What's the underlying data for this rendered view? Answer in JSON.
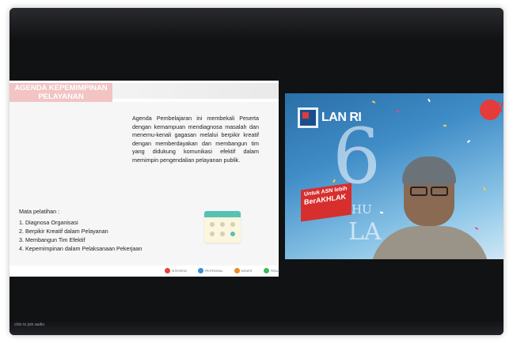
{
  "slide": {
    "title_line1": "AGENDA KEPEMIMPINAN",
    "title_line2": "PELAYANAN",
    "description": "Agenda Pembelajaran ini membekali Peserta dengan kemampuan mendiagnosa masalah dan menemu-kenali gagasan melalui berpikir kreatif dengan memberdayakan dan membangun tim yang didukung komunikasi efektif dalam memimpin pengendalian pelayanan publik.",
    "mata_title": "Mata pelatihan :",
    "mata_items": [
      "1.  Diagnosa Organisasi",
      "2.  Berpikir Kreatif dalam Pelayanan",
      "3.  Membangun Tim Efektif",
      "4.  Kepemimpinan dalam Pelaksanaan Pekerjaan"
    ],
    "icons": {
      "calendar": "calendar-icon"
    },
    "core_values": [
      {
        "label": "INTEGRITAS",
        "color": "#e0443c"
      },
      {
        "label": "PROFESIONAL",
        "color": "#3b8fd9"
      },
      {
        "label": "INOVATIF",
        "color": "#f08a2b"
      },
      {
        "label": "PEDULI",
        "color": "#3dbb5c"
      }
    ]
  },
  "video": {
    "logo_text": "LAN RI",
    "anniversary_number": "6",
    "tahun_text": "TAHU",
    "lan_text": "LA",
    "banner_line1": "Untuk ASN lebih",
    "banner_line2": "BerAKHLAK",
    "corner_mark": "7("
  },
  "self_view": {
    "name": "click to join audio"
  },
  "colors": {
    "frame_bg": "#111214",
    "slide_title_bg": "#f2c4c4",
    "video_bg": "#3f8cc7",
    "banner": "#d72e2e"
  }
}
